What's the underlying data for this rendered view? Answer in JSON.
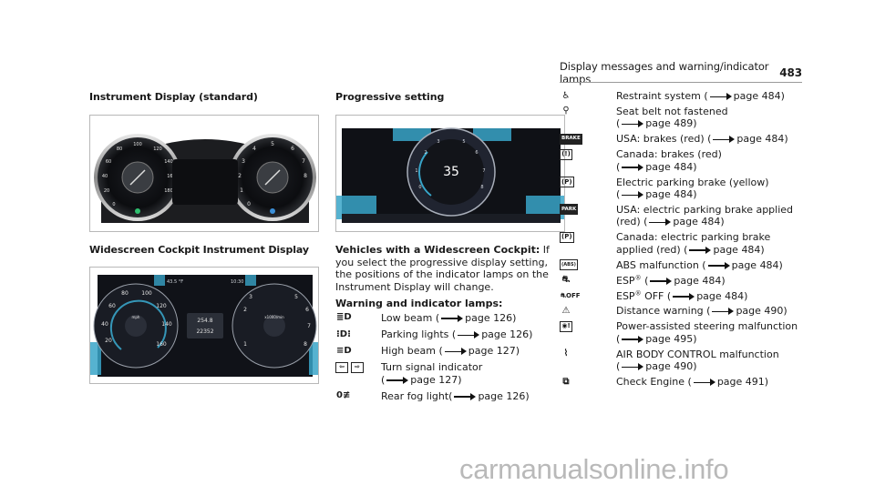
{
  "header": {
    "title": "Display messages and warning/indicator lamps",
    "page_number": "483"
  },
  "col1": {
    "heading1": "Instrument Display (standard)",
    "heading2": "Widescreen Cockpit Instrument Display",
    "fig2": {
      "temp": "43.5 °F",
      "time": "10:30",
      "odo_top": "254.8",
      "odo_bottom": "22352",
      "unit_left": "mph",
      "unit_right": "x1000/min"
    }
  },
  "col2": {
    "heading": "Progressive setting",
    "fig3": {
      "speed": "35"
    },
    "vehicles_bold": "Vehicles with a Widescreen Cockpit:",
    "vehicles_text": " If you select the progressive display setting, the positions of the indicator lamps on the Instrument Display will change.",
    "lamps_heading": "Warning and indicator lamps:",
    "lamps": [
      {
        "icon": "low-beam",
        "glyph": "≣D",
        "text": "Low beam (",
        "page": "page 126)"
      },
      {
        "icon": "parking-lights",
        "glyph": "⁝D⁝",
        "text": "Parking lights (",
        "page": "page 126)"
      },
      {
        "icon": "high-beam",
        "glyph": "≡D",
        "text": "High beam (",
        "page": "page 127)"
      },
      {
        "icon": "turn-signal",
        "glyph": "⇦ ⇨",
        "text": "Turn signal indicator",
        "line2": "(",
        "page": "page 127)"
      },
      {
        "icon": "rear-fog",
        "glyph": "0≢",
        "text": "Rear fog light(",
        "page": "page 126)"
      }
    ]
  },
  "col3": {
    "lamps": [
      {
        "icon": "restraint-system",
        "glyph": "♿",
        "text": "Restraint system (",
        "page": "page 484)"
      },
      {
        "icon": "seat-belt",
        "glyph": "⚲",
        "text": "Seat belt not fastened",
        "line2": "(",
        "page": "page 489)"
      },
      {
        "icon": "brake",
        "glyph": "BRAKE",
        "text": "USA: brakes (red) (",
        "page": "page 484)"
      },
      {
        "icon": "brake-canada",
        "glyph": "(!)",
        "text": "Canada: brakes (red)",
        "line2": "(",
        "page": "page 484)"
      },
      {
        "icon": "parking-brake",
        "glyph": "(P)",
        "text": "Electric parking brake (yellow)",
        "line2": "(",
        "page": "page 484)"
      },
      {
        "icon": "park",
        "glyph": "PARK",
        "text": "USA: electric parking brake applied",
        "line2_prefix": "(red) (",
        "page": "page 484)"
      },
      {
        "icon": "parking-brake-canada",
        "glyph": "(P)",
        "text": "Canada: electric parking brake",
        "line2_prefix": "applied (red) (",
        "page": "page 484)"
      },
      {
        "icon": "abs",
        "glyph": "(ABS)",
        "text": "ABS malfunction (",
        "page": "page 484)"
      },
      {
        "icon": "esp",
        "glyph": "⛐",
        "text_pre": "ESP",
        "text_post": " (",
        "page": "page 484)"
      },
      {
        "icon": "esp-off",
        "glyph": "⛐OFF",
        "text_pre": "ESP",
        "text_post": " OFF (",
        "page": "page 484)"
      },
      {
        "icon": "distance-warning",
        "glyph": "⚠",
        "text": "Distance warning (",
        "page": "page 490)"
      },
      {
        "icon": "steering",
        "glyph": "◉!",
        "text": "Power-assisted steering malfunction",
        "line2": "(",
        "page": "page 495)"
      },
      {
        "icon": "air-body-control",
        "glyph": "⌇",
        "text": "AIR BODY CONTROL malfunction",
        "line2": "(",
        "page": "page 490)"
      },
      {
        "icon": "check-engine",
        "glyph": "⧉",
        "text": "Check Engine (",
        "page": "page 491)"
      }
    ]
  },
  "watermark": "carmanualsonline.info"
}
